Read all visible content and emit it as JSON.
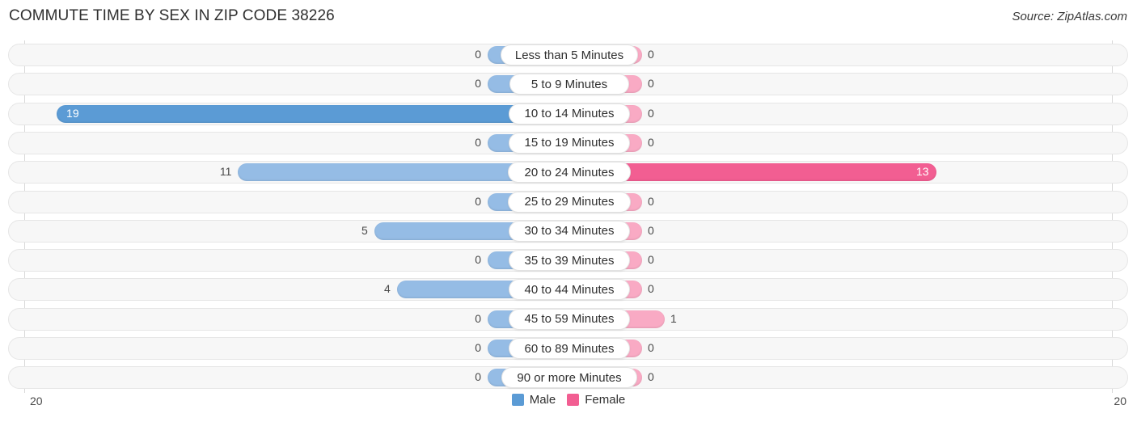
{
  "header": {
    "title": "COMMUTE TIME BY SEX IN ZIP CODE 38226",
    "source": "Source: ZipAtlas.com"
  },
  "axis": {
    "left_tick": "20",
    "right_tick": "20"
  },
  "legend": {
    "items": [
      {
        "label": "Male",
        "color": "#5b9bd5"
      },
      {
        "label": "Female",
        "color": "#f25e92"
      }
    ]
  },
  "colors": {
    "male_light": "#95bce5",
    "male_peak": "#5b9bd5",
    "female_light": "#f9aac4",
    "female_peak": "#f25e92",
    "track": "#f7f7f7"
  },
  "chart_data": {
    "type": "bar",
    "orientation": "horizontal-diverging",
    "title": "COMMUTE TIME BY SEX IN ZIP CODE 38226",
    "xlabel": "",
    "ylabel": "",
    "xlim": [
      20,
      20
    ],
    "grid": false,
    "legend_position": "bottom-center",
    "categories": [
      "Less than 5 Minutes",
      "5 to 9 Minutes",
      "10 to 14 Minutes",
      "15 to 19 Minutes",
      "20 to 24 Minutes",
      "25 to 29 Minutes",
      "30 to 34 Minutes",
      "35 to 39 Minutes",
      "40 to 44 Minutes",
      "45 to 59 Minutes",
      "60 to 89 Minutes",
      "90 or more Minutes"
    ],
    "series": [
      {
        "name": "Male",
        "side": "left",
        "values": [
          0,
          0,
          19,
          0,
          11,
          0,
          5,
          0,
          4,
          0,
          0,
          0
        ]
      },
      {
        "name": "Female",
        "side": "right",
        "values": [
          0,
          0,
          0,
          0,
          13,
          0,
          0,
          0,
          0,
          1,
          0,
          0
        ]
      }
    ],
    "value_labels": {
      "male": [
        "0",
        "0",
        "19",
        "0",
        "11",
        "0",
        "5",
        "0",
        "4",
        "0",
        "0",
        "0"
      ],
      "female": [
        "0",
        "0",
        "0",
        "0",
        "13",
        "0",
        "0",
        "0",
        "0",
        "1",
        "0",
        "0"
      ]
    }
  }
}
